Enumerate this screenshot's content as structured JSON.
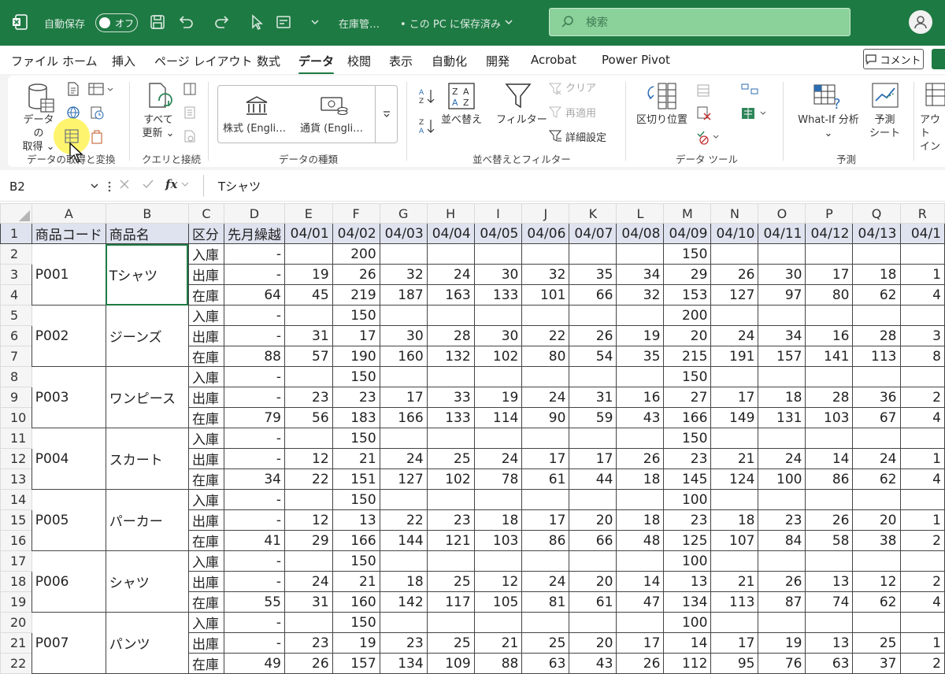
{
  "titlebar": {
    "autosave_label": "自動保存",
    "autosave_state": "オフ",
    "filename": "在庫管…",
    "save_status": "• この PC に保存済み",
    "search_placeholder": "検索"
  },
  "menu": {
    "tabs": [
      "ファイル",
      "ホーム",
      "挿入",
      "ページ レイアウト",
      "数式",
      "データ",
      "校閲",
      "表示",
      "自動化",
      "開発",
      "Acrobat",
      "Power Pivot"
    ],
    "active": "データ",
    "comment_label": "コメント"
  },
  "ribbon": {
    "get_data_label": "データの\n取得 ⌄",
    "get_transform_group": "データの取得と変換",
    "refresh_all_label": "すべて\n更新 ⌄",
    "queries_group": "クエリと接続",
    "stocks_label": "株式 (Engli…",
    "currency_label": "通貨 (Engli…",
    "data_types_group": "データの種類",
    "sort_label": "並べ替え",
    "filter_label": "フィルター",
    "clear_label": "クリア",
    "reapply_label": "再適用",
    "advanced_label": "詳細設定",
    "sort_filter_group": "並べ替えとフィルター",
    "text_to_columns_label": "区切り位置",
    "data_tools_group": "データ ツール",
    "whatif_label": "What-If 分析\n⌄",
    "forecast_sheet_label": "予測\nシート",
    "forecast_group": "予測",
    "outline_label": "アウト\nイン"
  },
  "formula_bar": {
    "name_box": "B2",
    "fx": "fx",
    "formula": "Tシャツ"
  },
  "sheet": {
    "columns": [
      "A",
      "B",
      "C",
      "D",
      "E",
      "F",
      "G",
      "H",
      "I",
      "J",
      "K",
      "L",
      "M",
      "N",
      "O",
      "P",
      "Q",
      "R"
    ],
    "header_row": [
      "商品コード",
      "商品名",
      "区分",
      "先月繰越",
      "04/01",
      "04/02",
      "04/03",
      "04/04",
      "04/05",
      "04/06",
      "04/07",
      "04/08",
      "04/09",
      "04/10",
      "04/11",
      "04/12",
      "04/13",
      "04/1"
    ],
    "products": [
      {
        "code": "P001",
        "name": "Tシャツ",
        "in": [
          "-",
          "",
          "200",
          "",
          "",
          "",
          "",
          "",
          "",
          "150",
          "",
          "",
          "",
          "",
          ""
        ],
        "out": [
          "-",
          "19",
          "26",
          "32",
          "24",
          "30",
          "32",
          "35",
          "34",
          "29",
          "26",
          "30",
          "17",
          "18",
          "1"
        ],
        "stock": [
          "64",
          "45",
          "219",
          "187",
          "163",
          "133",
          "101",
          "66",
          "32",
          "153",
          "127",
          "97",
          "80",
          "62",
          "4"
        ]
      },
      {
        "code": "P002",
        "name": "ジーンズ",
        "in": [
          "-",
          "",
          "150",
          "",
          "",
          "",
          "",
          "",
          "",
          "200",
          "",
          "",
          "",
          "",
          ""
        ],
        "out": [
          "-",
          "31",
          "17",
          "30",
          "28",
          "30",
          "22",
          "26",
          "19",
          "20",
          "24",
          "34",
          "16",
          "28",
          "3"
        ],
        "stock": [
          "88",
          "57",
          "190",
          "160",
          "132",
          "102",
          "80",
          "54",
          "35",
          "215",
          "191",
          "157",
          "141",
          "113",
          "8"
        ]
      },
      {
        "code": "P003",
        "name": "ワンピース",
        "in": [
          "-",
          "",
          "150",
          "",
          "",
          "",
          "",
          "",
          "",
          "150",
          "",
          "",
          "",
          "",
          ""
        ],
        "out": [
          "-",
          "23",
          "23",
          "17",
          "33",
          "19",
          "24",
          "31",
          "16",
          "27",
          "17",
          "18",
          "28",
          "36",
          "2"
        ],
        "stock": [
          "79",
          "56",
          "183",
          "166",
          "133",
          "114",
          "90",
          "59",
          "43",
          "166",
          "149",
          "131",
          "103",
          "67",
          "4"
        ]
      },
      {
        "code": "P004",
        "name": "スカート",
        "in": [
          "-",
          "",
          "150",
          "",
          "",
          "",
          "",
          "",
          "",
          "150",
          "",
          "",
          "",
          "",
          ""
        ],
        "out": [
          "-",
          "12",
          "21",
          "24",
          "25",
          "24",
          "17",
          "17",
          "26",
          "23",
          "21",
          "24",
          "14",
          "24",
          "1"
        ],
        "stock": [
          "34",
          "22",
          "151",
          "127",
          "102",
          "78",
          "61",
          "44",
          "18",
          "145",
          "124",
          "100",
          "86",
          "62",
          "4"
        ]
      },
      {
        "code": "P005",
        "name": "パーカー",
        "in": [
          "-",
          "",
          "150",
          "",
          "",
          "",
          "",
          "",
          "",
          "100",
          "",
          "",
          "",
          "",
          ""
        ],
        "out": [
          "-",
          "12",
          "13",
          "22",
          "23",
          "18",
          "17",
          "20",
          "18",
          "23",
          "18",
          "23",
          "26",
          "20",
          "1"
        ],
        "stock": [
          "41",
          "29",
          "166",
          "144",
          "121",
          "103",
          "86",
          "66",
          "48",
          "125",
          "107",
          "84",
          "58",
          "38",
          "2"
        ]
      },
      {
        "code": "P006",
        "name": "シャツ",
        "in": [
          "-",
          "",
          "150",
          "",
          "",
          "",
          "",
          "",
          "",
          "100",
          "",
          "",
          "",
          "",
          ""
        ],
        "out": [
          "-",
          "24",
          "21",
          "18",
          "25",
          "12",
          "24",
          "20",
          "14",
          "13",
          "21",
          "26",
          "13",
          "12",
          "2"
        ],
        "stock": [
          "55",
          "31",
          "160",
          "142",
          "117",
          "105",
          "81",
          "61",
          "47",
          "134",
          "113",
          "87",
          "74",
          "62",
          "4"
        ]
      },
      {
        "code": "P007",
        "name": "パンツ",
        "in": [
          "-",
          "",
          "150",
          "",
          "",
          "",
          "",
          "",
          "",
          "100",
          "",
          "",
          "",
          "",
          ""
        ],
        "out": [
          "-",
          "23",
          "19",
          "23",
          "25",
          "21",
          "25",
          "20",
          "17",
          "14",
          "17",
          "19",
          "13",
          "25",
          "1"
        ],
        "stock": [
          "49",
          "26",
          "157",
          "134",
          "109",
          "88",
          "63",
          "43",
          "26",
          "112",
          "95",
          "76",
          "63",
          "37",
          "2"
        ]
      }
    ],
    "categories": {
      "in": "入庫",
      "out": "出庫",
      "stock": "在庫"
    },
    "row_numbers": [
      "1",
      "2",
      "3",
      "4",
      "5",
      "6",
      "7",
      "8",
      "9",
      "10",
      "11",
      "12",
      "13",
      "14",
      "15",
      "16",
      "17",
      "18",
      "19",
      "20",
      "21",
      "22"
    ]
  }
}
